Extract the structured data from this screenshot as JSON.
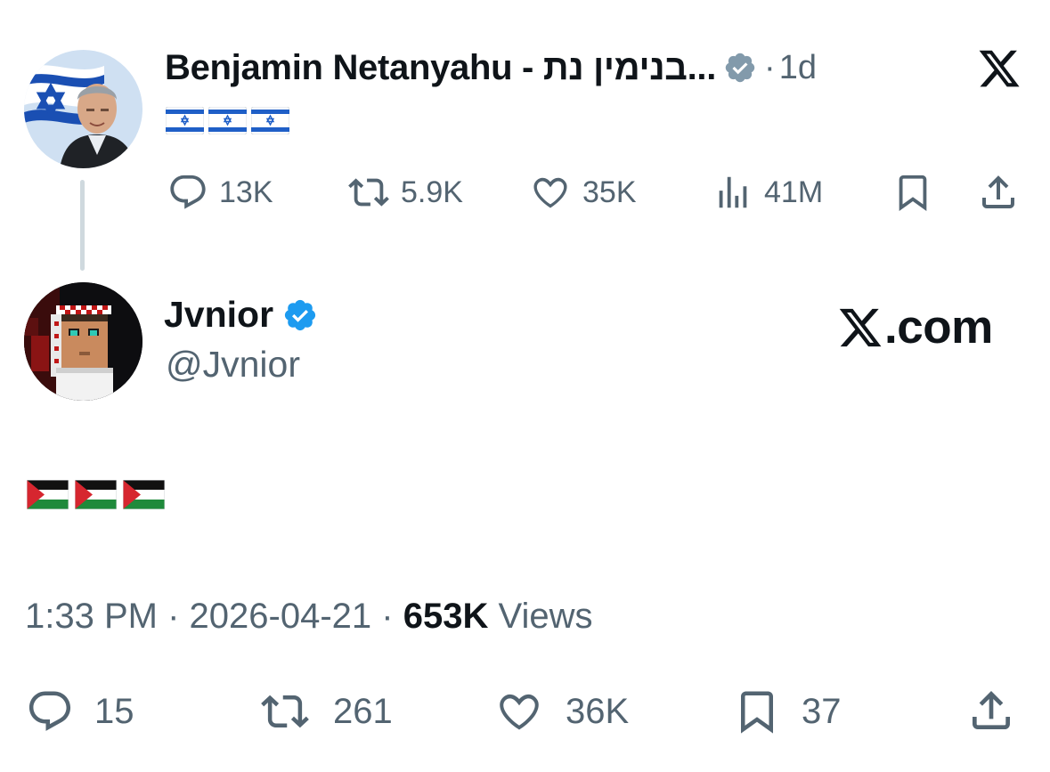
{
  "parent_tweet": {
    "display_name": "Benjamin Netanyahu - בנימין נת...",
    "separator": "·",
    "time_ago": "1d",
    "flag_emoji": [
      "israel-flag",
      "israel-flag",
      "israel-flag"
    ],
    "actions": {
      "replies": "13K",
      "reposts": "5.9K",
      "likes": "35K",
      "views": "41M"
    }
  },
  "reply_tweet": {
    "display_name": "Jvnior",
    "handle": "@Jvnior",
    "flag_emoji": [
      "palestine-flag",
      "palestine-flag",
      "palestine-flag"
    ],
    "timestamp": "1:33 PM",
    "date": "2026-04-21",
    "separator": "·",
    "view_count": "653K",
    "views_label": "Views",
    "actions": {
      "replies": "15",
      "reposts": "261",
      "likes": "36K",
      "bookmarks": "37"
    }
  },
  "watermark": {
    "text": ".com"
  },
  "colors": {
    "text": "#0f1419",
    "secondary": "#536471",
    "verified_grey": "#829aab",
    "verified_blue": "#1d9bf0",
    "thread_line": "#cfd9de"
  }
}
